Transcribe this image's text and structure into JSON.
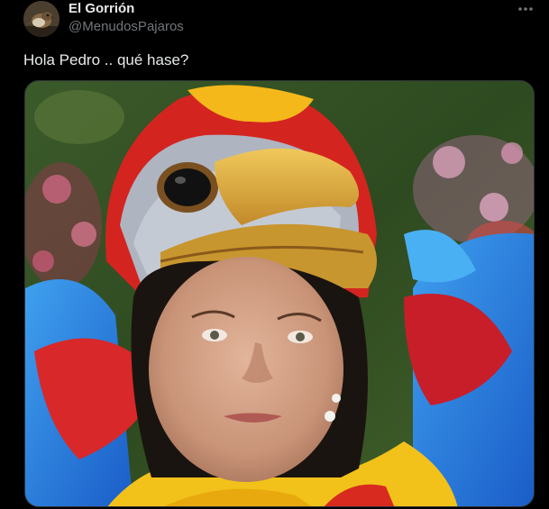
{
  "post": {
    "author_name": "El Gorrión",
    "author_handle": "@MenudosPajaros",
    "text": "Hola Pedro .. qué hase?",
    "more_icon": "more-horizontal-icon",
    "media_description": "parrot-costume-photo"
  },
  "colors": {
    "background": "#000000",
    "primary_text": "#e7e9ea",
    "secondary_text": "#71767b",
    "border": "#2f3336"
  }
}
